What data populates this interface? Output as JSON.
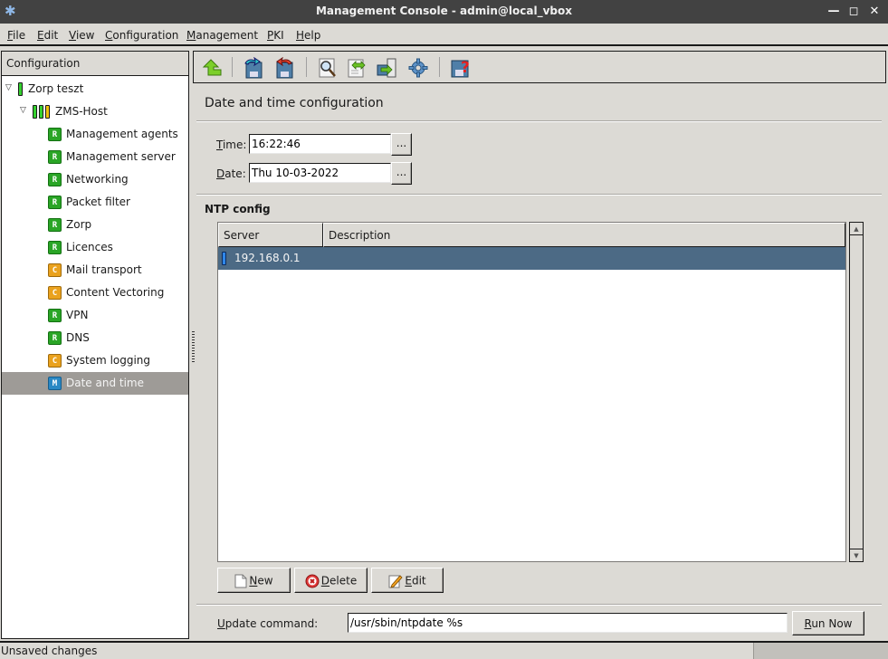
{
  "window": {
    "title": "Management Console - admin@local_vbox",
    "controls": {
      "minimize": "minimize",
      "maximize": "maximize",
      "close": "close"
    }
  },
  "menubar": {
    "items": [
      {
        "label": "File",
        "mnemonic": "F"
      },
      {
        "label": "Edit",
        "mnemonic": "E"
      },
      {
        "label": "View",
        "mnemonic": "V"
      },
      {
        "label": "Configuration",
        "mnemonic": "C"
      },
      {
        "label": "Management",
        "mnemonic": "M"
      },
      {
        "label": "PKI",
        "mnemonic": "P"
      },
      {
        "label": "Help",
        "mnemonic": "H"
      }
    ]
  },
  "toolbar": {
    "buttons": [
      {
        "name": "go-up",
        "icon": "arrow-up-icon"
      },
      {
        "name": "commit",
        "icon": "save-commit-icon"
      },
      {
        "name": "revert",
        "icon": "save-revert-icon"
      },
      {
        "name": "view",
        "icon": "magnifier-icon"
      },
      {
        "name": "compare",
        "icon": "compare-icon"
      },
      {
        "name": "upload",
        "icon": "upload-to-host-icon"
      },
      {
        "name": "control",
        "icon": "gear-icon"
      },
      {
        "name": "status",
        "icon": "save-question-icon"
      }
    ]
  },
  "sidebar": {
    "header": "Configuration",
    "tree": [
      {
        "label": "Zorp teszt",
        "level": 0,
        "expanded": true,
        "status": [
          "#35d12f"
        ]
      },
      {
        "label": "ZMS-Host",
        "level": 1,
        "expanded": true,
        "status": [
          "#35d12f",
          "#35d12f",
          "#f0c20c"
        ]
      },
      {
        "label": "Management agents",
        "level": 2,
        "badge": "R"
      },
      {
        "label": "Management server",
        "level": 2,
        "badge": "R"
      },
      {
        "label": "Networking",
        "level": 2,
        "badge": "R"
      },
      {
        "label": "Packet filter",
        "level": 2,
        "badge": "R"
      },
      {
        "label": "Zorp",
        "level": 2,
        "badge": "R"
      },
      {
        "label": "Licences",
        "level": 2,
        "badge": "R"
      },
      {
        "label": "Mail transport",
        "level": 2,
        "badge": "C"
      },
      {
        "label": "Content Vectoring",
        "level": 2,
        "badge": "C"
      },
      {
        "label": "VPN",
        "level": 2,
        "badge": "R"
      },
      {
        "label": "DNS",
        "level": 2,
        "badge": "R"
      },
      {
        "label": "System logging",
        "level": 2,
        "badge": "C"
      },
      {
        "label": "Date and time",
        "level": 2,
        "badge": "M",
        "selected": true
      }
    ]
  },
  "main": {
    "title": "Date and time configuration",
    "time": {
      "label": "Time:",
      "mnemonic": "T",
      "value": "16:22:46",
      "picker_label": "..."
    },
    "date": {
      "label": "Date:",
      "mnemonic": "D",
      "value": "Thu 10-03-2022",
      "picker_label": "..."
    },
    "ntp": {
      "section_title": "NTP config",
      "columns": [
        "Server",
        "Description"
      ],
      "rows": [
        {
          "server": "192.168.0.1",
          "description": "",
          "selected": true,
          "status_color": "#2f86e8"
        }
      ],
      "buttons": {
        "new": {
          "label": "New",
          "mnemonic": "N"
        },
        "delete": {
          "label": "Delete",
          "mnemonic": "D"
        },
        "edit": {
          "label": "Edit",
          "mnemonic": "E"
        }
      }
    },
    "update_command": {
      "label": "Update command:",
      "mnemonic": "U",
      "value": "/usr/sbin/ntpdate %s",
      "run_label": "Run Now",
      "run_mnemonic": "R"
    }
  },
  "statusbar": {
    "message": "Unsaved changes"
  },
  "colors": {
    "titlebar": "#424242",
    "window_bg": "#dcdad5",
    "selection_tree": "#9e9b97",
    "selection_table": "#4c6a85",
    "badge_r": "#2aa526",
    "badge_c": "#eaa21e",
    "badge_m": "#2a88c4"
  }
}
